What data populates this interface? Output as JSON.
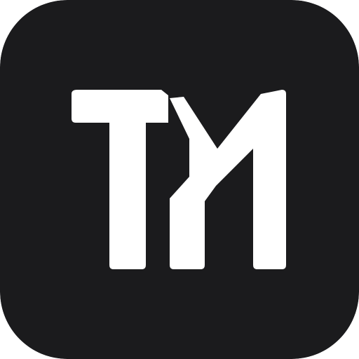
{
  "logo": {
    "text": "TM",
    "icon": "tm-monogram-logo-icon",
    "colors": {
      "background": "#1b1b1d",
      "foreground": "#ffffff"
    }
  }
}
